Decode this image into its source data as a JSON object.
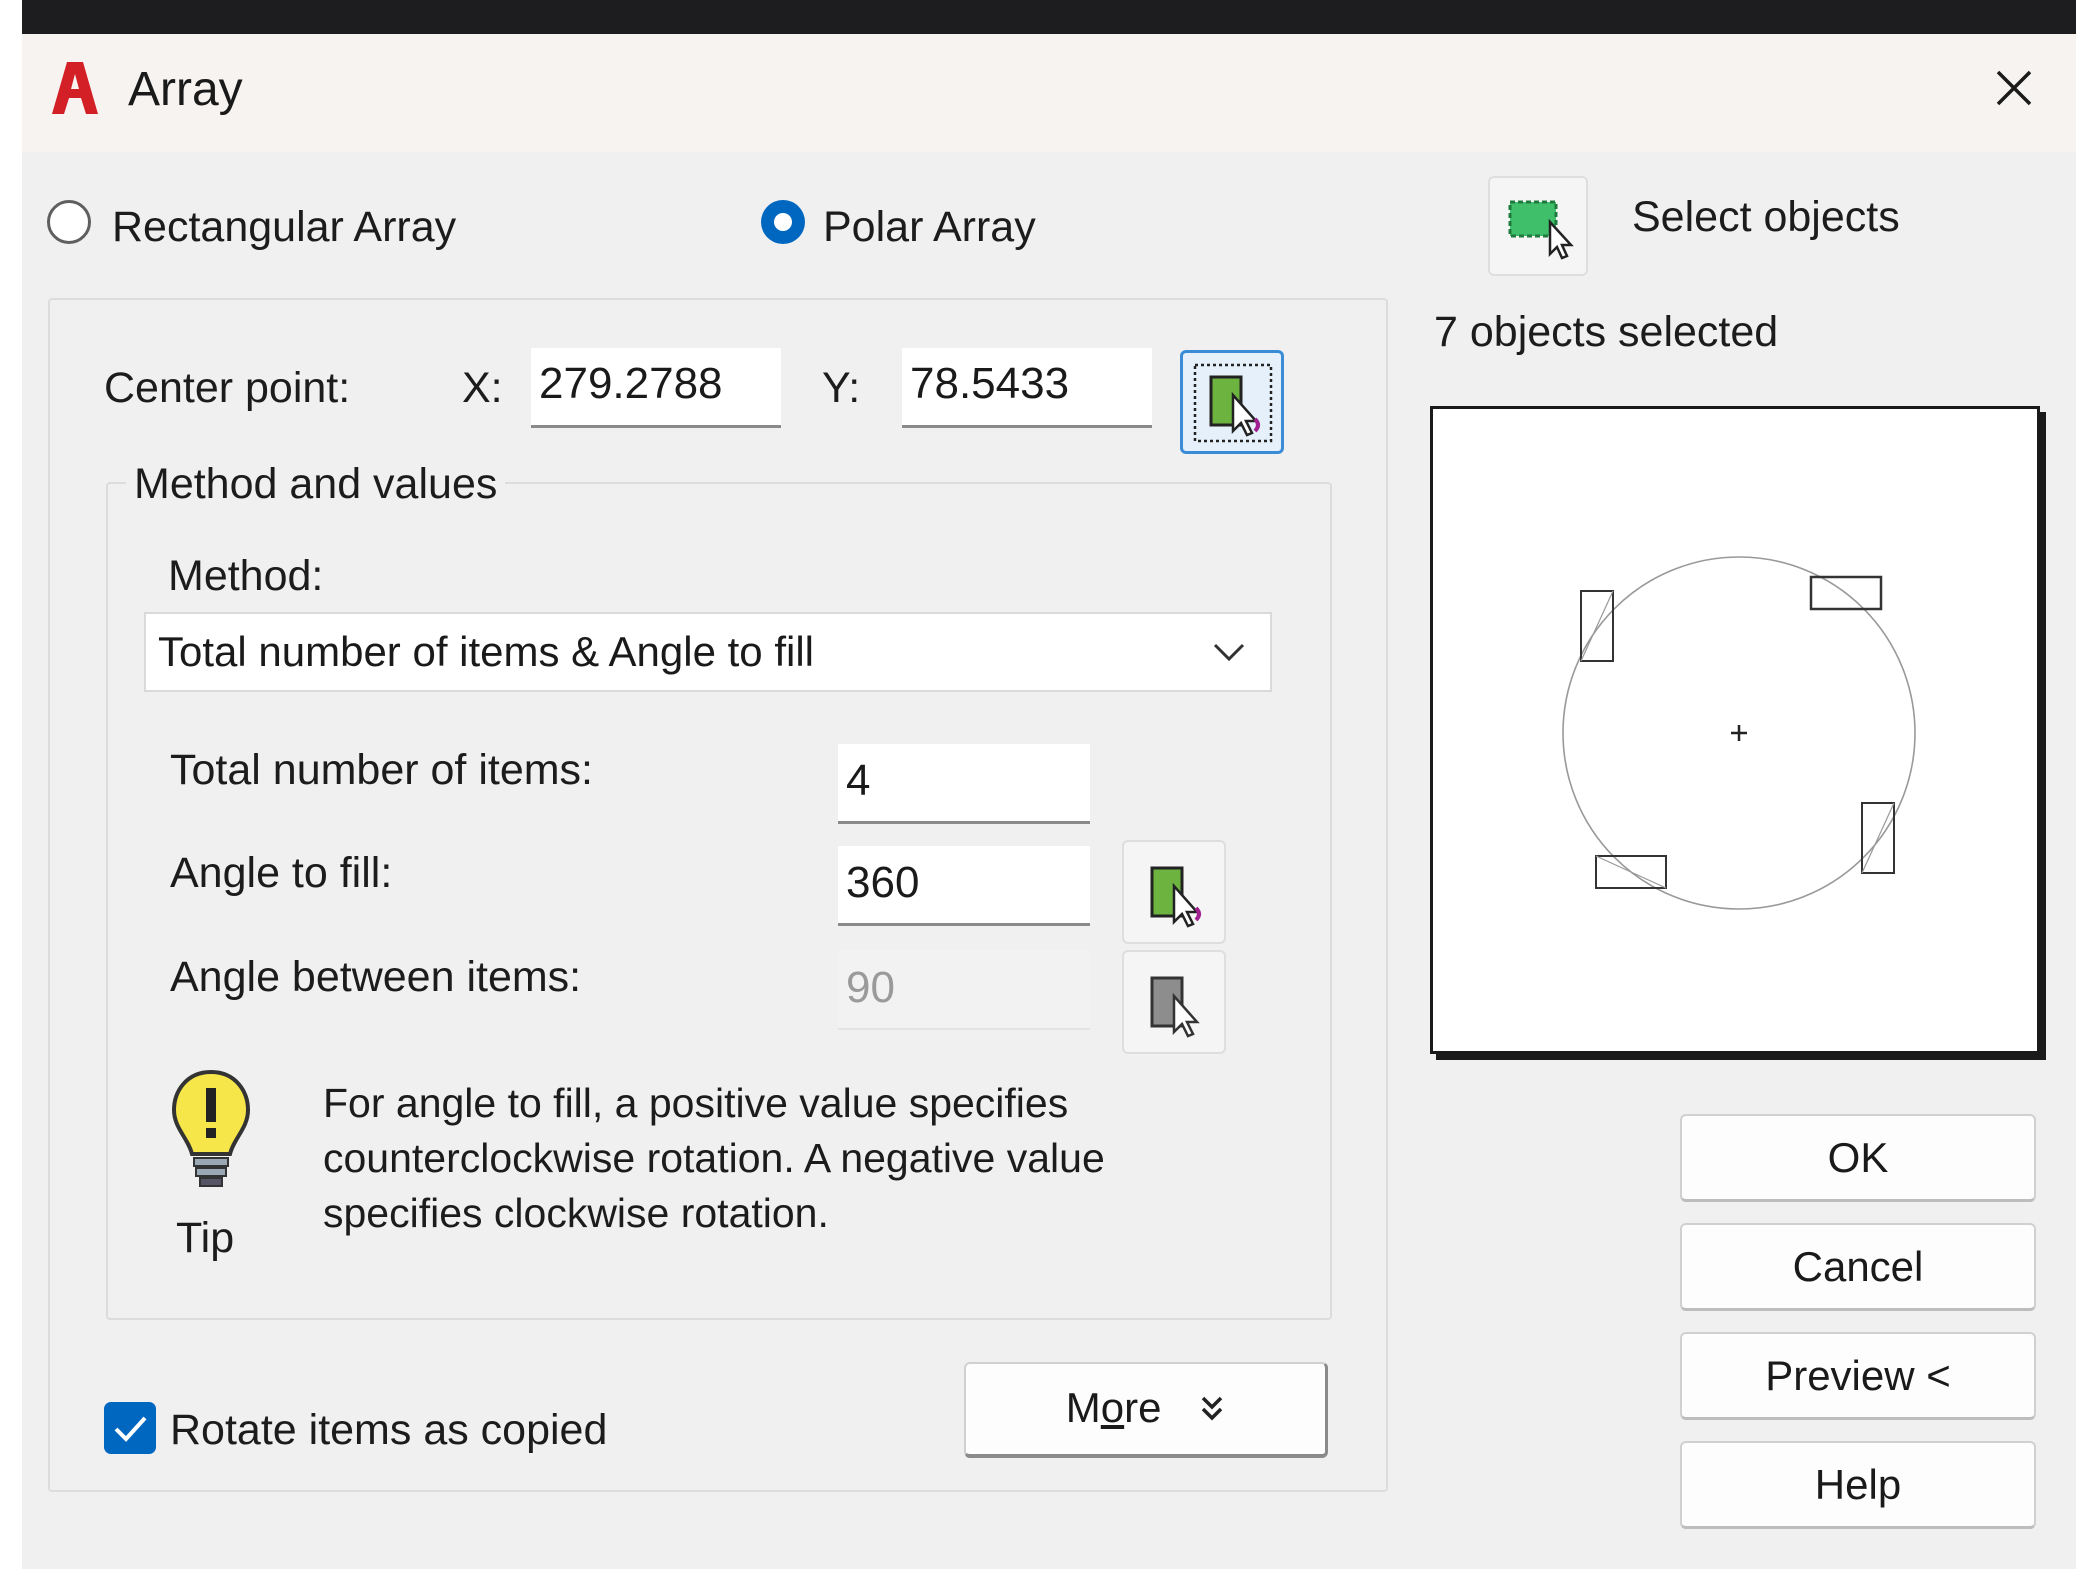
{
  "window": {
    "title": "Array",
    "close_label": "close"
  },
  "array_type": {
    "rectangular_label": "Rectangular Array",
    "polar_label": "Polar Array",
    "selected": "Polar Array"
  },
  "selection": {
    "select_objects_label": "Select objects",
    "status": "7 objects selected"
  },
  "center_point": {
    "label": "Center point:",
    "x_label": "X:",
    "x_value": "279.2788",
    "y_label": "Y:",
    "y_value": "78.5433"
  },
  "method_group": {
    "title": "Method and values",
    "method_label": "Method:",
    "method_value": "Total number of items & Angle to fill",
    "items_label": "Total number of items:",
    "items_value": "4",
    "fill_label": "Angle to fill:",
    "fill_value": "360",
    "between_label": "Angle between items:",
    "between_value": "90"
  },
  "tip": {
    "label": "Tip",
    "line1": "For angle to fill, a positive value specifies",
    "line2": "counterclockwise rotation.  A negative value",
    "line3": "specifies clockwise rotation."
  },
  "rotate": {
    "label": "Rotate items as copied",
    "checked": true
  },
  "more_button": {
    "label_prefix": "M",
    "label_underlined": "o",
    "label_suffix": "re",
    "icon": "double-chevron-down-icon"
  },
  "buttons": {
    "ok": "OK",
    "cancel": "Cancel",
    "preview": "Preview <",
    "help": "Help"
  },
  "colors": {
    "accent": "#0067c0",
    "title_bar": "#f7f3f1",
    "dialog_bg": "#f0f0f0",
    "logo_red": "#d31f26"
  }
}
